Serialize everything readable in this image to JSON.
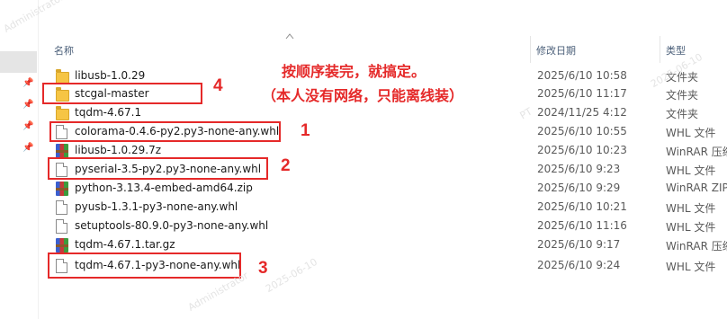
{
  "watermark": {
    "text": "Administrator",
    "date": "2025-06-10",
    "pt": "PT"
  },
  "columns": {
    "name": "名称",
    "date": "修改日期",
    "type": "类型"
  },
  "files": [
    {
      "name": "libusb-1.0.29",
      "date": "2025/6/10 10:58",
      "type": "文件夹",
      "icon": "folder-icon"
    },
    {
      "name": "stcgal-master",
      "date": "2025/6/10 11:17",
      "type": "文件夹",
      "icon": "folder-icon"
    },
    {
      "name": "tqdm-4.67.1",
      "date": "2024/11/25 4:12",
      "type": "文件夹",
      "icon": "folder-icon"
    },
    {
      "name": "colorama-0.4.6-py2.py3-none-any.whl",
      "date": "2025/6/10 10:55",
      "type": "WHL 文件",
      "icon": "file-icon"
    },
    {
      "name": "libusb-1.0.29.7z",
      "date": "2025/6/10 10:23",
      "type": "WinRAR 压缩",
      "icon": "winrar-icon"
    },
    {
      "name": "pyserial-3.5-py2.py3-none-any.whl",
      "date": "2025/6/10 9:23",
      "type": "WHL 文件",
      "icon": "file-icon"
    },
    {
      "name": "python-3.13.4-embed-amd64.zip",
      "date": "2025/6/10 9:29",
      "type": "WinRAR ZIP",
      "icon": "winrar-icon"
    },
    {
      "name": "pyusb-1.3.1-py3-none-any.whl",
      "date": "2025/6/10 10:21",
      "type": "WHL 文件",
      "icon": "file-icon"
    },
    {
      "name": "setuptools-80.9.0-py3-none-any.whl",
      "date": "2025/6/10 11:16",
      "type": "WHL 文件",
      "icon": "file-icon"
    },
    {
      "name": "tqdm-4.67.1.tar.gz",
      "date": "2025/6/10 9:17",
      "type": "WinRAR 压缩",
      "icon": "winrar-icon"
    },
    {
      "name": "tqdm-4.67.1-py3-none-any.whl",
      "date": "2025/6/10 9:24",
      "type": "WHL 文件",
      "icon": "file-icon"
    }
  ],
  "annotations": {
    "note_line1": "按顺序装完，就搞定。",
    "note_line2": "（本人没有网络，只能离线装）",
    "n1": "1",
    "n2": "2",
    "n3": "3",
    "n4": "4",
    "color": "#e52929"
  }
}
